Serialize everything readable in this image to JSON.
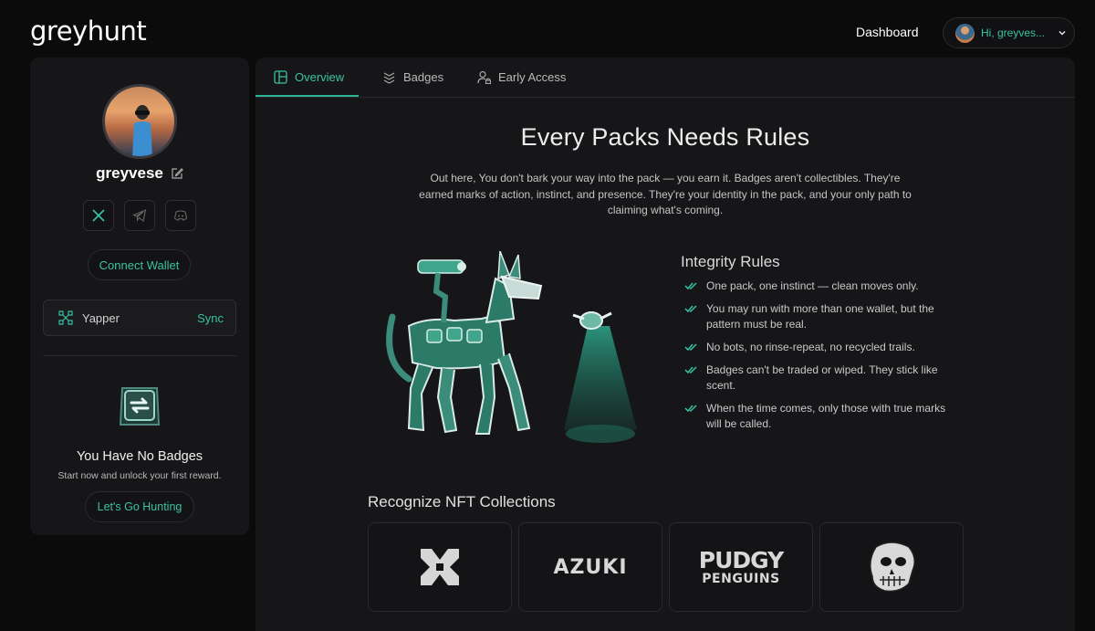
{
  "header": {
    "logo": "greyhunt",
    "nav_dashboard": "Dashboard",
    "user_greeting": "Hi, greyves..."
  },
  "sidebar": {
    "username": "greyvese",
    "connect_wallet": "Connect Wallet",
    "yapper_label": "Yapper",
    "yapper_action": "Sync",
    "no_badges_title": "You Have No Badges",
    "no_badges_subtitle": "Start now and unlock your first reward.",
    "go_hunting": "Let's Go Hunting"
  },
  "tabs": [
    {
      "label": "Overview",
      "icon": "layout-icon",
      "active": true
    },
    {
      "label": "Badges",
      "icon": "layers-icon",
      "active": false
    },
    {
      "label": "Early Access",
      "icon": "user-lock-icon",
      "active": false
    }
  ],
  "hero": {
    "title": "Every Packs Needs Rules",
    "description": "Out here, You don't bark your way into the pack — you earn it.  Badges aren't collectibles. They're earned marks of action, instinct, and presence. They're your identity in the pack, and your only path to claiming what's coming."
  },
  "rules": {
    "title": "Integrity Rules",
    "items": [
      "One pack, one instinct — clean moves only.",
      "You may run with more than one wallet, but the pattern must be real.",
      "No bots, no rinse-repeat, no recycled trails.",
      "Badges can't be traded or wiped. They stick like scent.",
      "When the time comes, only those with true marks will be called."
    ]
  },
  "nft": {
    "title": "Recognize NFT Collections",
    "collections": [
      {
        "name": "x-logo"
      },
      {
        "name": "AZUKI"
      },
      {
        "name_line1": "PUDGY",
        "name_line2": "PENGUINS"
      },
      {
        "name": "ape-skull-logo"
      }
    ]
  },
  "colors": {
    "accent": "#39c2a4",
    "background": "#0b0b0c",
    "panel": "#161618"
  }
}
